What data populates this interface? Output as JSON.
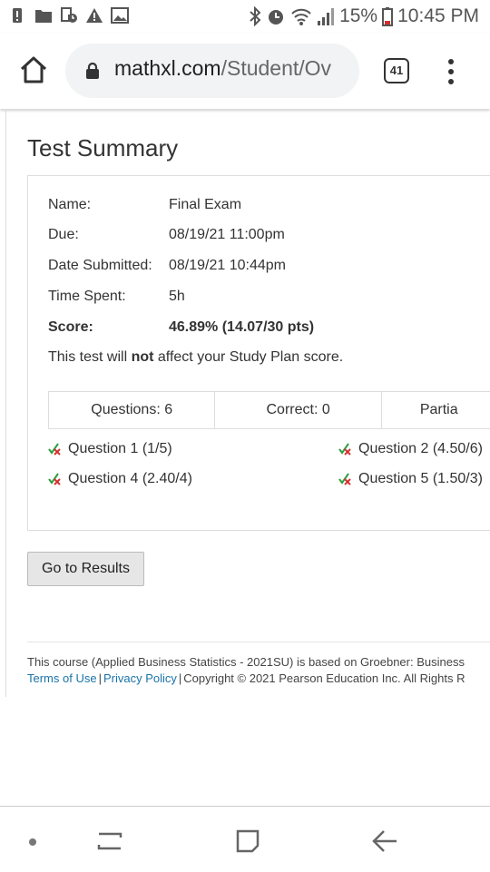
{
  "status_bar": {
    "battery_percent": "15%",
    "time": "10:45 PM"
  },
  "browser": {
    "url_domain": "mathxl.com",
    "url_path": "/Student/Ov",
    "tab_count": "41"
  },
  "page": {
    "title": "Test Summary",
    "fields": [
      {
        "label": "Name:",
        "value": "Final Exam"
      },
      {
        "label": "Due:",
        "value": "08/19/21 11:00pm"
      },
      {
        "label": "Date Submitted:",
        "value": "08/19/21 10:44pm"
      },
      {
        "label": "Time Spent:",
        "value": "5h"
      },
      {
        "label": "Score:",
        "value": "46.89% (14.07/30 pts)"
      }
    ],
    "note_before": "This test will ",
    "note_bold": "not",
    "note_after": " affect your Study Plan score.",
    "stats": [
      "Questions: 6",
      "Correct: 0",
      "Partia"
    ],
    "questions": [
      "Question 1 (1/5)",
      "Question 2 (4.50/6)",
      "Question 4 (2.40/4)",
      "Question 5 (1.50/3)"
    ],
    "results_button": "Go to Results",
    "footer": {
      "course_text": "This course (Applied Business Statistics - 2021SU) is based on Groebner: Business",
      "terms": "Terms of Use",
      "privacy": "Privacy Policy",
      "copyright": "Copyright © 2021 Pearson Education Inc. All Rights R"
    }
  },
  "colors": {
    "link": "#1a73a8",
    "partial_icon_green": "#2e9e3e",
    "partial_icon_red": "#d32f2f"
  }
}
